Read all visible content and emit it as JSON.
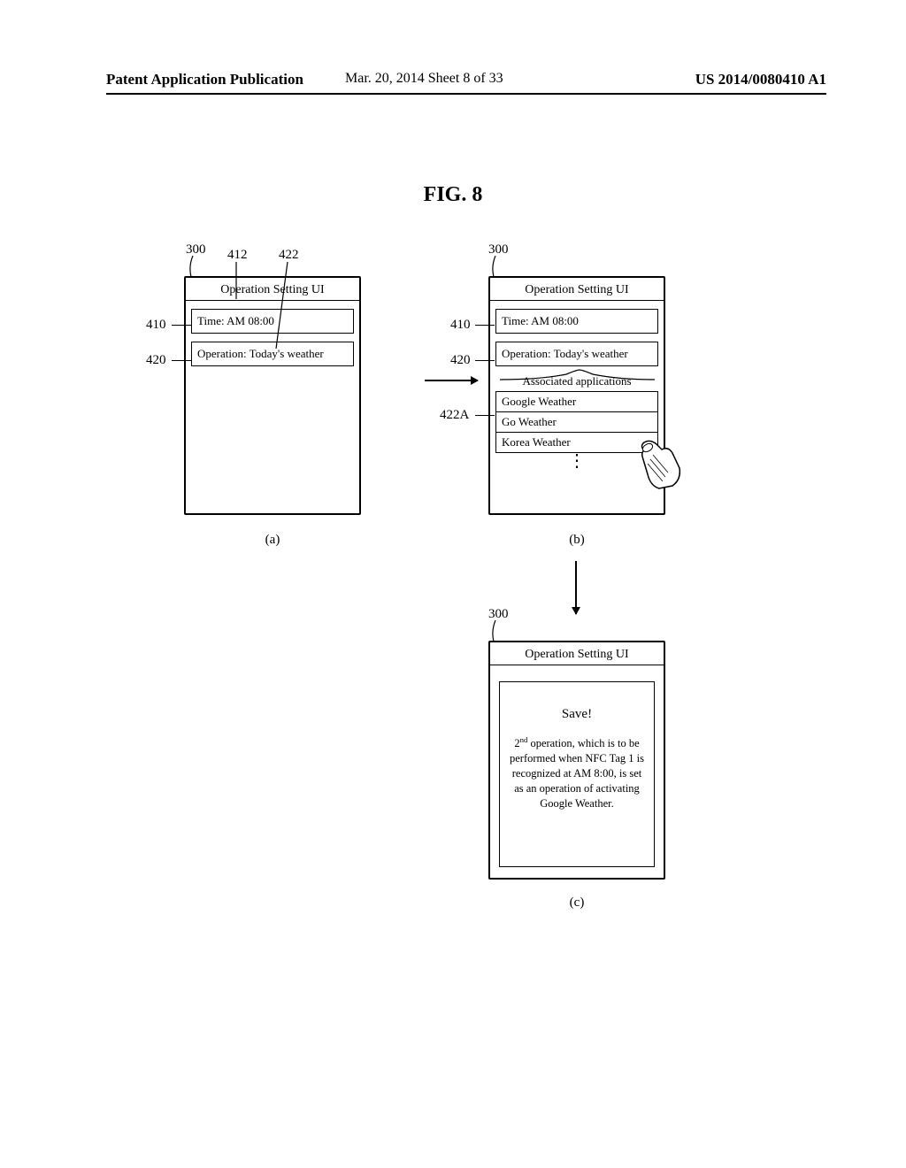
{
  "header": {
    "left": "Patent Application Publication",
    "middle": "Mar. 20, 2014  Sheet 8 of 33",
    "right": "US 2014/0080410 A1"
  },
  "figure_title": "FIG. 8",
  "refs": {
    "r300": "300",
    "r412": "412",
    "r422": "422",
    "r410": "410",
    "r420": "420",
    "r422a": "422A"
  },
  "panel_a": {
    "title": "Operation Setting UI",
    "time_row": "Time: AM 08:00",
    "operation_row": "Operation: Today's weather",
    "sub": "(a)"
  },
  "panel_b": {
    "title": "Operation Setting UI",
    "time_row": "Time: AM 08:00",
    "operation_row": "Operation: Today's weather",
    "assoc_label": "Associated applications",
    "apps": [
      "Google Weather",
      "Go Weather",
      "Korea Weather"
    ],
    "sub": "(b)"
  },
  "panel_c": {
    "title": "Operation Setting UI",
    "save_label": "Save!",
    "save_msg_pre": "2",
    "save_msg_sup": "nd",
    "save_msg_post": " operation, which is to be performed when NFC Tag 1 is recognized at AM 8:00, is set as an operation of activating Google Weather.",
    "sub": "(c)"
  }
}
